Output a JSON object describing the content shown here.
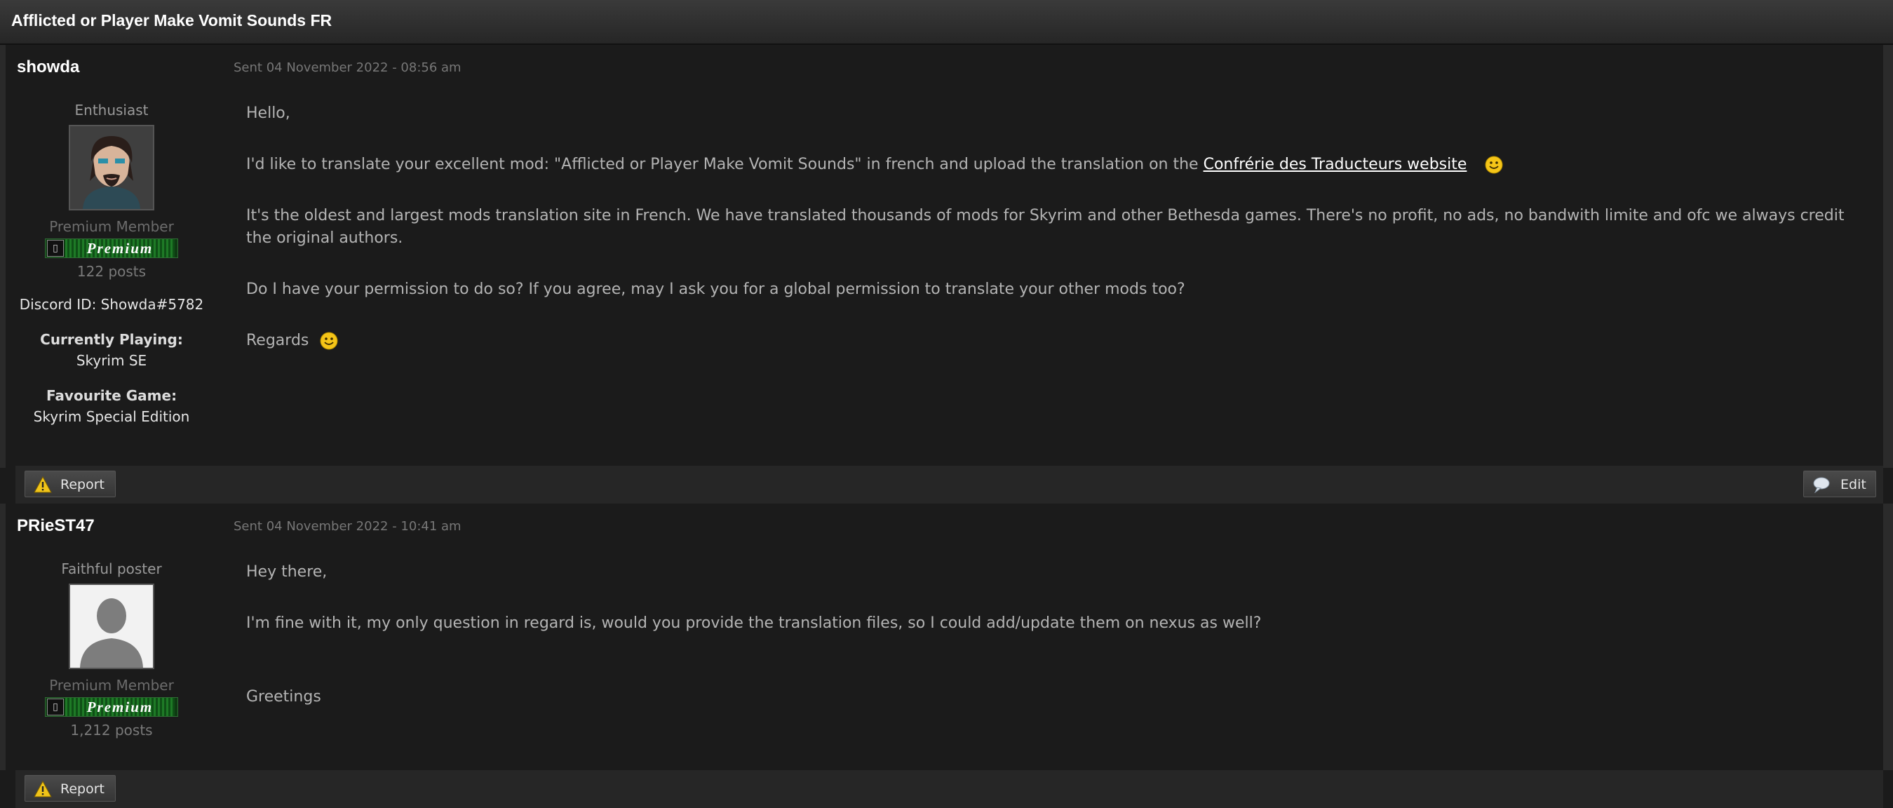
{
  "topic": {
    "title": "Afflicted or Player Make Vomit Sounds FR"
  },
  "posts": [
    {
      "author": "showda",
      "sent": "Sent 04 November 2022 - 08:56 am",
      "rank": "Enthusiast",
      "member_group": "Premium Member",
      "badge_label": "Premium",
      "post_count": "122 posts",
      "discord": "Discord ID: Showda#5782",
      "fields": [
        {
          "label": "Currently Playing:",
          "value": "Skyrim SE"
        },
        {
          "label": "Favourite Game:",
          "value": "Skyrim Special Edition"
        }
      ],
      "body": {
        "p1": "Hello,",
        "p2_pre": "I'd like to translate your excellent mod: \"Afflicted or Player Make Vomit Sounds\" in french and upload the translation on the ",
        "p2_link": "Confrérie des Traducteurs website",
        "p3": "It's the oldest and largest mods translation site in French. We have translated thousands of mods for Skyrim and other Bethesda games. There's no profit, no ads, no bandwith limite and ofc we always credit the original authors.",
        "p4": "Do I have your permission to do so? If you agree, may I ask you for a global permission to translate your other mods too?",
        "p5": "Regards"
      },
      "actions": {
        "report": "Report",
        "edit": "Edit"
      }
    },
    {
      "author": "PRieST47",
      "sent": "Sent 04 November 2022 - 10:41 am",
      "rank": "Faithful poster",
      "member_group": "Premium Member",
      "badge_label": "Premium",
      "post_count": "1,212 posts",
      "body": {
        "p1": "Hey there,",
        "p2": "I'm fine with it, my only question in regard is, would you provide the translation files, so I could add/update them on nexus as well?",
        "p3": "Greetings"
      },
      "actions": {
        "report": "Report"
      }
    }
  ],
  "icons": {
    "warning": "warning-icon",
    "edit": "speech-bubble-icon",
    "smiley": "smiley-icon",
    "badge": "premium-badge-icon"
  },
  "colors": {
    "link": "#ffffff",
    "badge_green": "#1e7a26"
  }
}
